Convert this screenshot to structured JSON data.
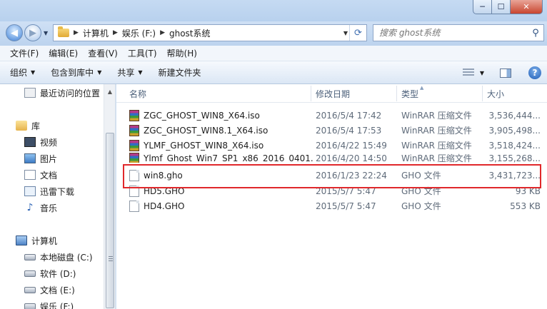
{
  "window": {
    "minimize": "─",
    "maximize": "☐",
    "close": "✕"
  },
  "address": {
    "crumbs": [
      "计算机",
      "娱乐 (F:)",
      "ghost系统"
    ],
    "search_placeholder": "搜索 ghost系统"
  },
  "menu": [
    "文件(F)",
    "编辑(E)",
    "查看(V)",
    "工具(T)",
    "帮助(H)"
  ],
  "toolbar": {
    "organize": "组织",
    "include_library": "包含到库中",
    "share": "共享",
    "new_folder": "新建文件夹"
  },
  "nav": {
    "recent": "最近访问的位置",
    "library": "库",
    "videos": "视频",
    "pictures": "图片",
    "documents": "文档",
    "thunder": "迅雷下载",
    "music": "音乐",
    "computer": "计算机",
    "drive_c": "本地磁盘 (C:)",
    "drive_d": "软件 (D:)",
    "drive_e": "文档 (E:)",
    "drive_f": "娱乐 (F:)"
  },
  "columns": {
    "name": "名称",
    "date": "修改日期",
    "type": "类型",
    "size": "大小"
  },
  "files": [
    {
      "name": "ZGC_GHOST_WIN8_X64.iso",
      "date": "2016/5/4 17:42",
      "type": "WinRAR 压缩文件",
      "size": "3,536,444...",
      "icon": "winrar-archive-icon"
    },
    {
      "name": "ZGC_GHOST_WIN8.1_X64.iso",
      "date": "2016/5/4 17:53",
      "type": "WinRAR 压缩文件",
      "size": "3,905,498...",
      "icon": "winrar-archive-icon"
    },
    {
      "name": "YLMF_GHOST_WIN8_X64.iso",
      "date": "2016/4/22 15:49",
      "type": "WinRAR 压缩文件",
      "size": "3,518,424...",
      "icon": "winrar-archive-icon"
    },
    {
      "name": "Ylmf_Ghost_Win7_SP1_x86_2016_0401...",
      "date": "2016/4/20 14:50",
      "type": "WinRAR 压缩文件",
      "size": "3,155,268...",
      "icon": "winrar-archive-icon"
    },
    {
      "name": "win8.gho",
      "date": "2016/1/23 22:24",
      "type": "GHO 文件",
      "size": "3,431,723...",
      "icon": "blank-file-icon"
    },
    {
      "name": "HD5.GHO",
      "date": "2015/5/7 5:47",
      "type": "GHO 文件",
      "size": "93 KB",
      "icon": "blank-file-icon"
    },
    {
      "name": "HD4.GHO",
      "date": "2015/5/7 5:47",
      "type": "GHO 文件",
      "size": "553 KB",
      "icon": "blank-file-icon"
    }
  ],
  "colors": {
    "highlight": "#e0282b",
    "chrome": "#c5daf2"
  }
}
